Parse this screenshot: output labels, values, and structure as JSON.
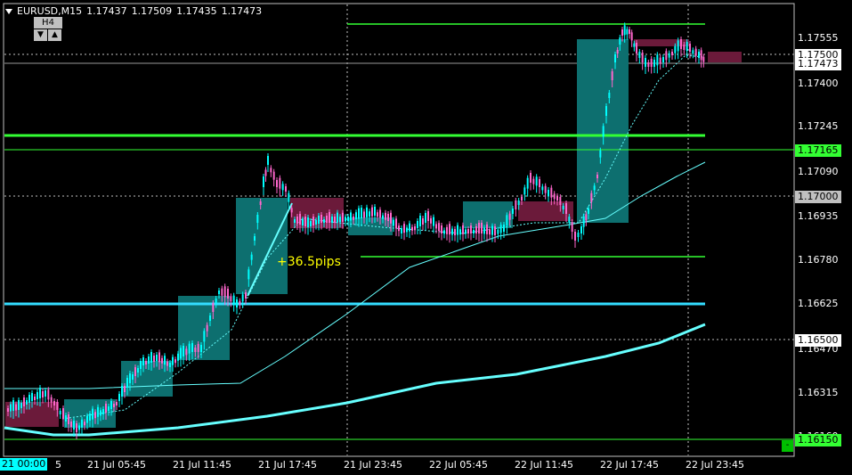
{
  "header": {
    "symbol": "EURUSD,M15",
    "open": "1.17437",
    "high": "1.17509",
    "low": "1.17435",
    "close": "1.17473"
  },
  "timeframe_box": {
    "label": "H4",
    "down": "▼",
    "up": "▲"
  },
  "annotation": "+36.5pips",
  "price_labels": [
    "1.17555",
    "1.17400",
    "1.17245",
    "1.17090",
    "1.16935",
    "1.16780",
    "1.16625",
    "1.16470",
    "1.16315",
    "1.16160"
  ],
  "price_boxes": {
    "p1": "1.17500",
    "p2": "1.17473",
    "p3": "1.17165",
    "p4": "1.17000",
    "p5": "1.16500",
    "p6": "1.16150"
  },
  "time_labels": [
    "21 Jul 05:45",
    "21 Jul 11:45",
    "21 Jul 17:45",
    "21 Jul 23:45",
    "22 Jul 05:45",
    "22 Jul 11:45",
    "22 Jul 17:45",
    "22 Jul 23:45"
  ],
  "time_box": "21 00:00",
  "time_box_tail": "5",
  "corner_button": "-",
  "colors": {
    "background": "#000000",
    "bull_candle": "#00ffff",
    "bear_candle": "#ff66cc",
    "bull_box": "#0d6f6f",
    "bear_box": "#6b1a3a",
    "level_line": "#33ff33",
    "ma_line": "#66ffff"
  }
}
